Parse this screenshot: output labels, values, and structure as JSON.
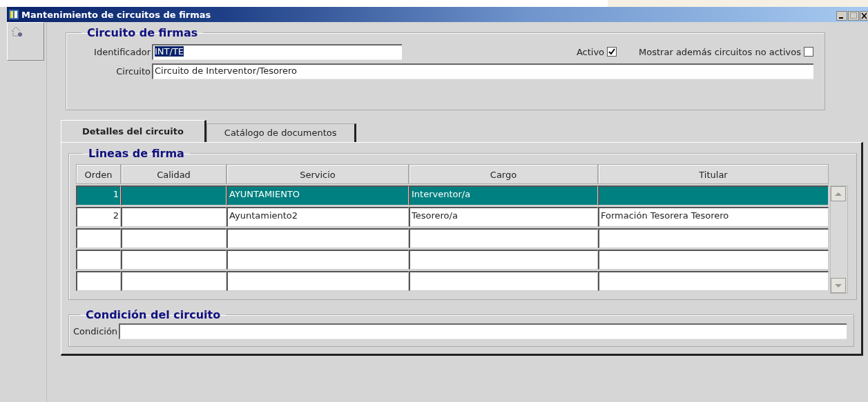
{
  "window": {
    "title": "Mantenimiento de circuitos de firmas"
  },
  "header_group": {
    "title": "Circuito de firmas",
    "identificador": {
      "label": "Identificador",
      "value": "INT/TE",
      "text_selected": true
    },
    "activo": {
      "label": "Activo",
      "checked": true
    },
    "mostrar": {
      "label": "Mostrar además circuitos no activos",
      "checked": false
    },
    "circuito": {
      "label": "Circuito",
      "value": "Circuito de Interventor/Tesorero"
    }
  },
  "tabs": [
    {
      "label": "Detalles del circuito",
      "selected": true
    },
    {
      "label": "Catálogo de documentos",
      "selected": false
    }
  ],
  "lines_group": {
    "title": "Lineas de firma",
    "table": {
      "columns": [
        "Orden",
        "Calidad",
        "Servicio",
        "Cargo",
        "Titular"
      ],
      "rows": [
        {
          "selected": true,
          "cells": [
            "1",
            null,
            "AYUNTAMIENTO",
            "Interventor/a",
            null
          ]
        },
        {
          "selected": false,
          "cells": [
            "2",
            null,
            "Ayuntamiento2",
            "Tesorero/a",
            "Formación Tesorera Tesorero"
          ]
        }
      ]
    }
  },
  "condition_group": {
    "title": "Condición del circuito",
    "field": {
      "label": "Condición"
    }
  }
}
